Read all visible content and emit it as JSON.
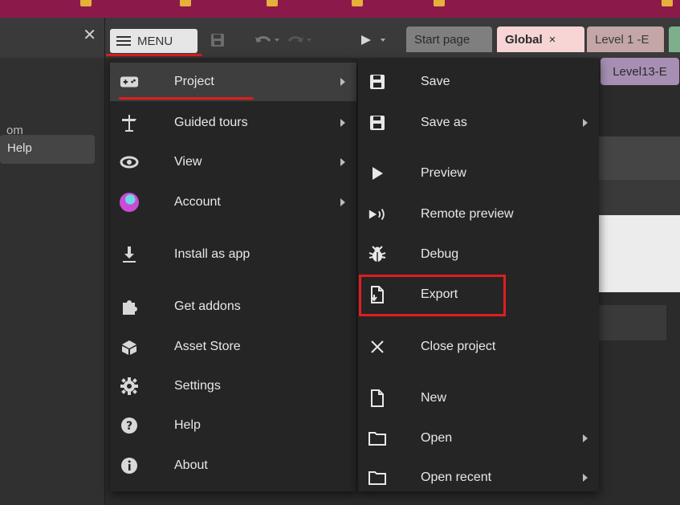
{
  "left_panel": {
    "partial_text": "om",
    "help_item": "Help"
  },
  "toolbar": {
    "menu_label": "MENU",
    "play_icon": "play-icon"
  },
  "tabs": [
    {
      "label": "Start page"
    },
    {
      "label": "Global",
      "close": "×"
    },
    {
      "label": "Level 1 -E"
    },
    {
      "label": "Level13-E"
    }
  ],
  "main_menu": {
    "items": [
      {
        "label": "Project",
        "icon": "gamepad-icon",
        "submenu": true,
        "active": true
      },
      {
        "label": "Guided tours",
        "icon": "signpost-icon",
        "submenu": true
      },
      {
        "label": "View",
        "icon": "eye-icon",
        "submenu": true
      },
      {
        "label": "Account",
        "icon": "avatar-icon",
        "submenu": true
      },
      {
        "label": "Install as app",
        "icon": "download-icon"
      },
      {
        "label": "Get addons",
        "icon": "puzzle-icon"
      },
      {
        "label": "Asset Store",
        "icon": "store-box-icon"
      },
      {
        "label": "Settings",
        "icon": "gear-icon"
      },
      {
        "label": "Help",
        "icon": "question-icon"
      },
      {
        "label": "About",
        "icon": "info-icon"
      }
    ]
  },
  "project_submenu": {
    "items": [
      {
        "label": "Save",
        "icon": "save-icon"
      },
      {
        "label": "Save as",
        "icon": "save-as-icon",
        "submenu": true
      },
      {
        "label": "Preview",
        "icon": "play-icon"
      },
      {
        "label": "Remote preview",
        "icon": "remote-preview-icon"
      },
      {
        "label": "Debug",
        "icon": "bug-icon"
      },
      {
        "label": "Export",
        "icon": "export-icon",
        "highlighted": true
      },
      {
        "label": "Close project",
        "icon": "close-icon"
      },
      {
        "label": "New",
        "icon": "new-file-icon"
      },
      {
        "label": "Open",
        "icon": "folder-icon",
        "submenu": true
      },
      {
        "label": "Open recent",
        "icon": "folder-recent-icon",
        "submenu": true
      }
    ]
  },
  "colors": {
    "titlebar": "#8b1a4a",
    "highlight_red": "#e01d1d",
    "menu_bg": "#252525"
  }
}
